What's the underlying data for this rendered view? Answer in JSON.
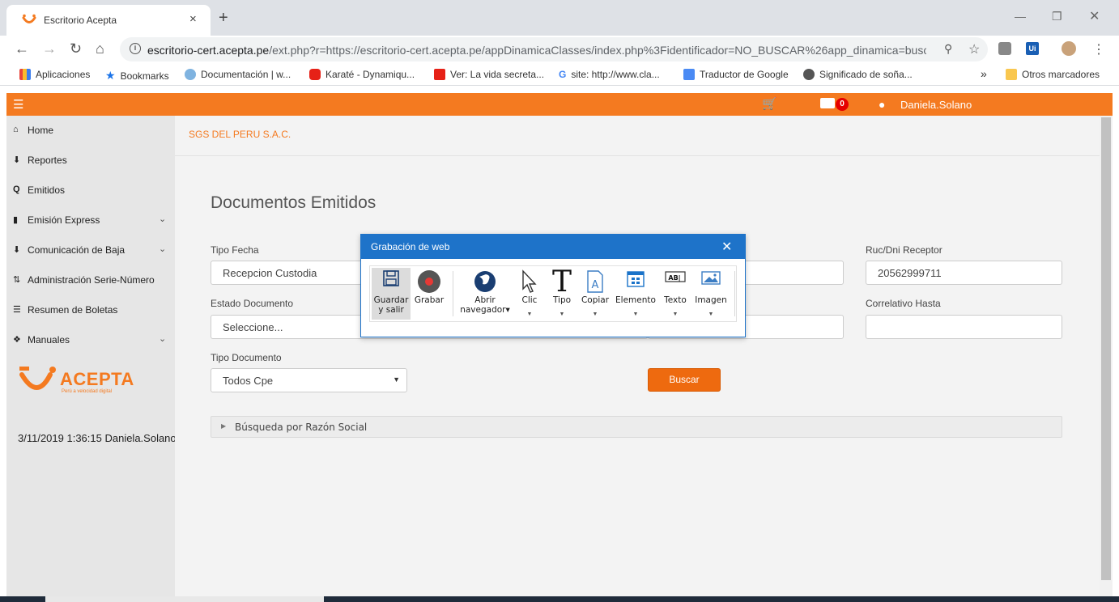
{
  "browser": {
    "tab_title": "Escritorio Acepta",
    "tab_close": "×",
    "new_tab": "+",
    "url_host": "escritorio-cert.acepta.pe",
    "url_rest": "/ext.php?r=https://escritorio-cert.acepta.pe/appDinamicaClasses/index.php%3Fidentificador=NO_BUSCAR%26app_dinamica=busc...",
    "bookmarks": [
      "Aplicaciones",
      "Bookmarks",
      "Documentación | w...",
      "Karaté - Dynamiqu...",
      "Ver: La vida secreta...",
      "site: http://www.cla...",
      "Traductor de Google",
      "Significado de soña..."
    ],
    "bookmarks_overflow": "»",
    "other_bookmarks": "Otros marcadores"
  },
  "appbar": {
    "mail_count": "0",
    "user_name": "Daniela.Solano"
  },
  "sidebar": {
    "items": [
      {
        "label": "Home",
        "icon": "home-icon"
      },
      {
        "label": "Reportes",
        "icon": "download-icon"
      },
      {
        "label": "Emitidos",
        "icon": "search-icon"
      },
      {
        "label": "Emisión Express",
        "icon": "file-icon"
      },
      {
        "label": "Comunicación de Baja",
        "icon": "download-icon"
      },
      {
        "label": "Administración Serie-Número",
        "icon": "sort-icon"
      },
      {
        "label": "Resumen de Boletas",
        "icon": "list-icon"
      },
      {
        "label": "Manuales",
        "icon": "info-icon"
      }
    ],
    "logo_text": "ACEPTA",
    "logo_sub": "Perú a velocidad digital",
    "status": "3/11/2019 1:36:15 Daniela.Solano"
  },
  "main": {
    "company": "SGS DEL PERU S.A.C.",
    "title": "Documentos Emitidos",
    "fields": {
      "tipo_fecha_label": "Tipo Fecha",
      "tipo_fecha_value": "Recepcion Custodia",
      "estado_label": "Estado Documento",
      "estado_value": "Seleccione...",
      "tipo_doc_label": "Tipo Documento",
      "tipo_doc_value": "Todos Cpe",
      "ruc_label": "Ruc/Dni Receptor",
      "ruc_value": "20562999711",
      "correlativo_label": "Correlativo Hasta",
      "correlativo_value": ""
    },
    "search_button": "Buscar",
    "accordion": "Búsqueda por Razón Social"
  },
  "recorder": {
    "title": "Grabación de web",
    "tools": [
      {
        "label1": "Guardar",
        "label2": "y salir"
      },
      {
        "label1": "Grabar",
        "label2": ""
      },
      {
        "label1": "Abrir",
        "label2": "navegador"
      },
      {
        "label1": "Clic",
        "label2": ""
      },
      {
        "label1": "Tipo",
        "label2": ""
      },
      {
        "label1": "Copiar",
        "label2": ""
      },
      {
        "label1": "Elemento",
        "label2": ""
      },
      {
        "label1": "Texto",
        "label2": ""
      },
      {
        "label1": "Imagen",
        "label2": ""
      }
    ],
    "colors": {
      "header": "#1e73c9",
      "record": "#e53935"
    }
  },
  "colors": {
    "brand": "#f47a20",
    "button": "#ee6a0f"
  }
}
